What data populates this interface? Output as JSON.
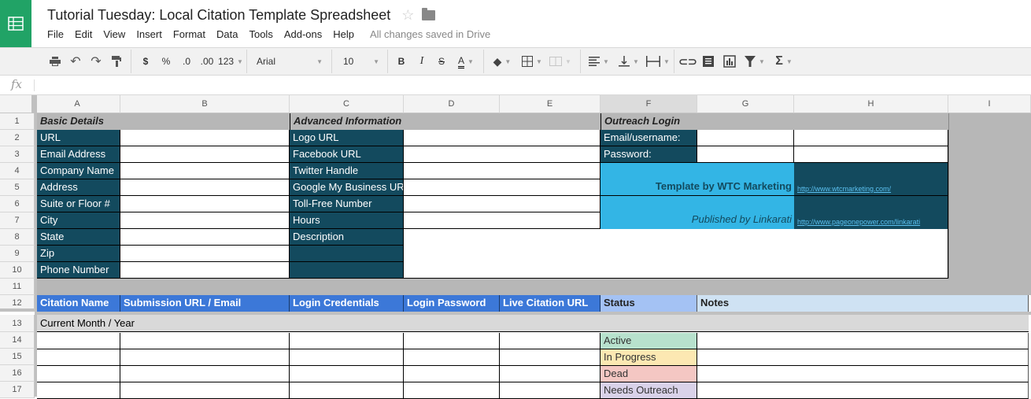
{
  "app": {
    "doc_title": "Tutorial Tuesday: Local Citation Template Spreadsheet",
    "menu": [
      "File",
      "Edit",
      "View",
      "Insert",
      "Format",
      "Data",
      "Tools",
      "Add-ons",
      "Help"
    ],
    "save_status": "All changes saved in Drive"
  },
  "toolbar": {
    "currency": "$",
    "percent": "%",
    "decrease_decimal": ".0",
    "increase_decimal": ".00",
    "more_formats": "123",
    "font": "Arial",
    "font_size": "10",
    "bold": "B",
    "italic": "I",
    "strike": "S",
    "text_color": "A",
    "sum": "Σ"
  },
  "formula_bar": {
    "fx": "fx",
    "value": ""
  },
  "columns": [
    "A",
    "B",
    "C",
    "D",
    "E",
    "F",
    "G",
    "H",
    "I"
  ],
  "rows": [
    "1",
    "2",
    "3",
    "4",
    "5",
    "6",
    "7",
    "8",
    "9",
    "10",
    "11",
    "12",
    "13",
    "14",
    "15",
    "16",
    "17"
  ],
  "sheet": {
    "basic_title": "Basic Details",
    "basic_labels": [
      "URL",
      "Email Address",
      "Company Name",
      "Address",
      "Suite or Floor #",
      "City",
      "State",
      "Zip",
      "Phone Number"
    ],
    "advanced_title": "Advanced Information",
    "advanced_labels": [
      "Logo URL",
      "Facebook URL",
      "Twitter Handle",
      "Google My Business URL",
      "Toll-Free Number",
      "Hours",
      "Description"
    ],
    "outreach_title": "Outreach Login",
    "outreach_labels": [
      "Email/username:",
      "Password:"
    ],
    "template_by": "Template by WTC Marketing",
    "template_link": "http://www.wtcmarketing.com/",
    "published_by": "Published by Linkarati",
    "published_link": "http://www.pageonepower.com/linkarati",
    "headers": [
      "Citation Name",
      "Submission URL / Email",
      "Login Credentials",
      "Login Password",
      "Live Citation URL",
      "Status",
      "Notes"
    ],
    "month_row": "Current Month / Year",
    "statuses": [
      {
        "label": "Active",
        "color": "#b7e1cd"
      },
      {
        "label": "In Progress",
        "color": "#fce8b2"
      },
      {
        "label": "Dead",
        "color": "#f4c7c3"
      },
      {
        "label": "Needs Outreach",
        "color": "#d9d2e9"
      }
    ]
  }
}
